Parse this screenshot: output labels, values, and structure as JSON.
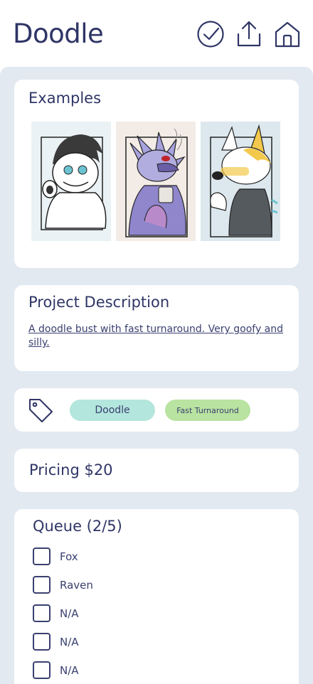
{
  "header": {
    "title": "Doodle",
    "icons": [
      "check-circle-icon",
      "share-icon",
      "home-icon"
    ]
  },
  "examples": {
    "title": "Examples",
    "images": [
      {
        "name": "example-image-1"
      },
      {
        "name": "example-image-2"
      },
      {
        "name": "example-image-3"
      }
    ]
  },
  "description": {
    "title": "Project Description",
    "text": "A doodle bust with fast turnaround. Very goofy and silly."
  },
  "tags": {
    "icon": "tag-icon",
    "items": [
      {
        "label": "Doodle",
        "color": "#b3e6dc"
      },
      {
        "label": "Fast Turnaround",
        "color": "#b8e3a0"
      }
    ]
  },
  "pricing": {
    "text": "Pricing $20"
  },
  "queue": {
    "title": "Queue (2/5)",
    "items": [
      {
        "label": "Fox"
      },
      {
        "label": "Raven"
      },
      {
        "label": "N/A"
      },
      {
        "label": "N/A"
      },
      {
        "label": "N/A"
      }
    ]
  },
  "colors": {
    "text": "#2f3566",
    "background": "#e2e9f1",
    "card": "#ffffff"
  }
}
